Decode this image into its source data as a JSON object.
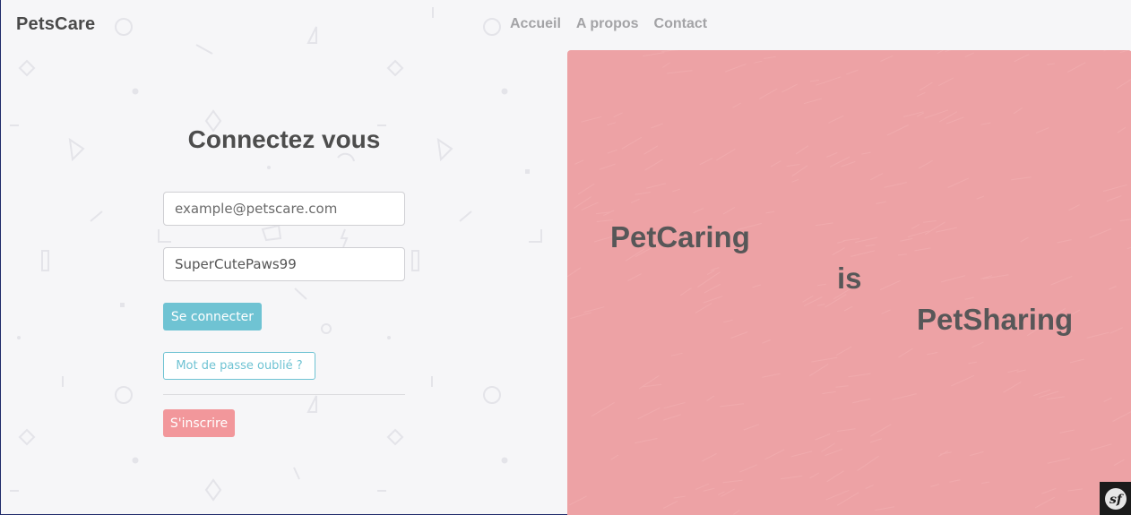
{
  "header": {
    "brand": "PetsCare",
    "nav": [
      "Accueil",
      "A propos",
      "Contact"
    ]
  },
  "login": {
    "title": "Connectez vous",
    "email": {
      "placeholder": "example@petscare.com",
      "value": ""
    },
    "password": {
      "value": "SuperCutePaws99"
    },
    "submit_label": "Se connecter",
    "forgot_label": "Mot de passe oublié ?",
    "register_label": "S'inscrire"
  },
  "hero": {
    "words": [
      "PetCaring",
      "is",
      "PetSharing"
    ]
  },
  "colors": {
    "page_background": "#f6f6f8",
    "hero_background": "#eda2a5",
    "accent_teal": "#6fc3d3",
    "accent_pink": "#f2979b",
    "text_dark": "#4d4d4d",
    "nav_text": "#a3a3a6"
  },
  "icons": {
    "background_pattern": "geometric-shapes-pattern",
    "toolbar_badge": "symfony-logo-icon"
  }
}
